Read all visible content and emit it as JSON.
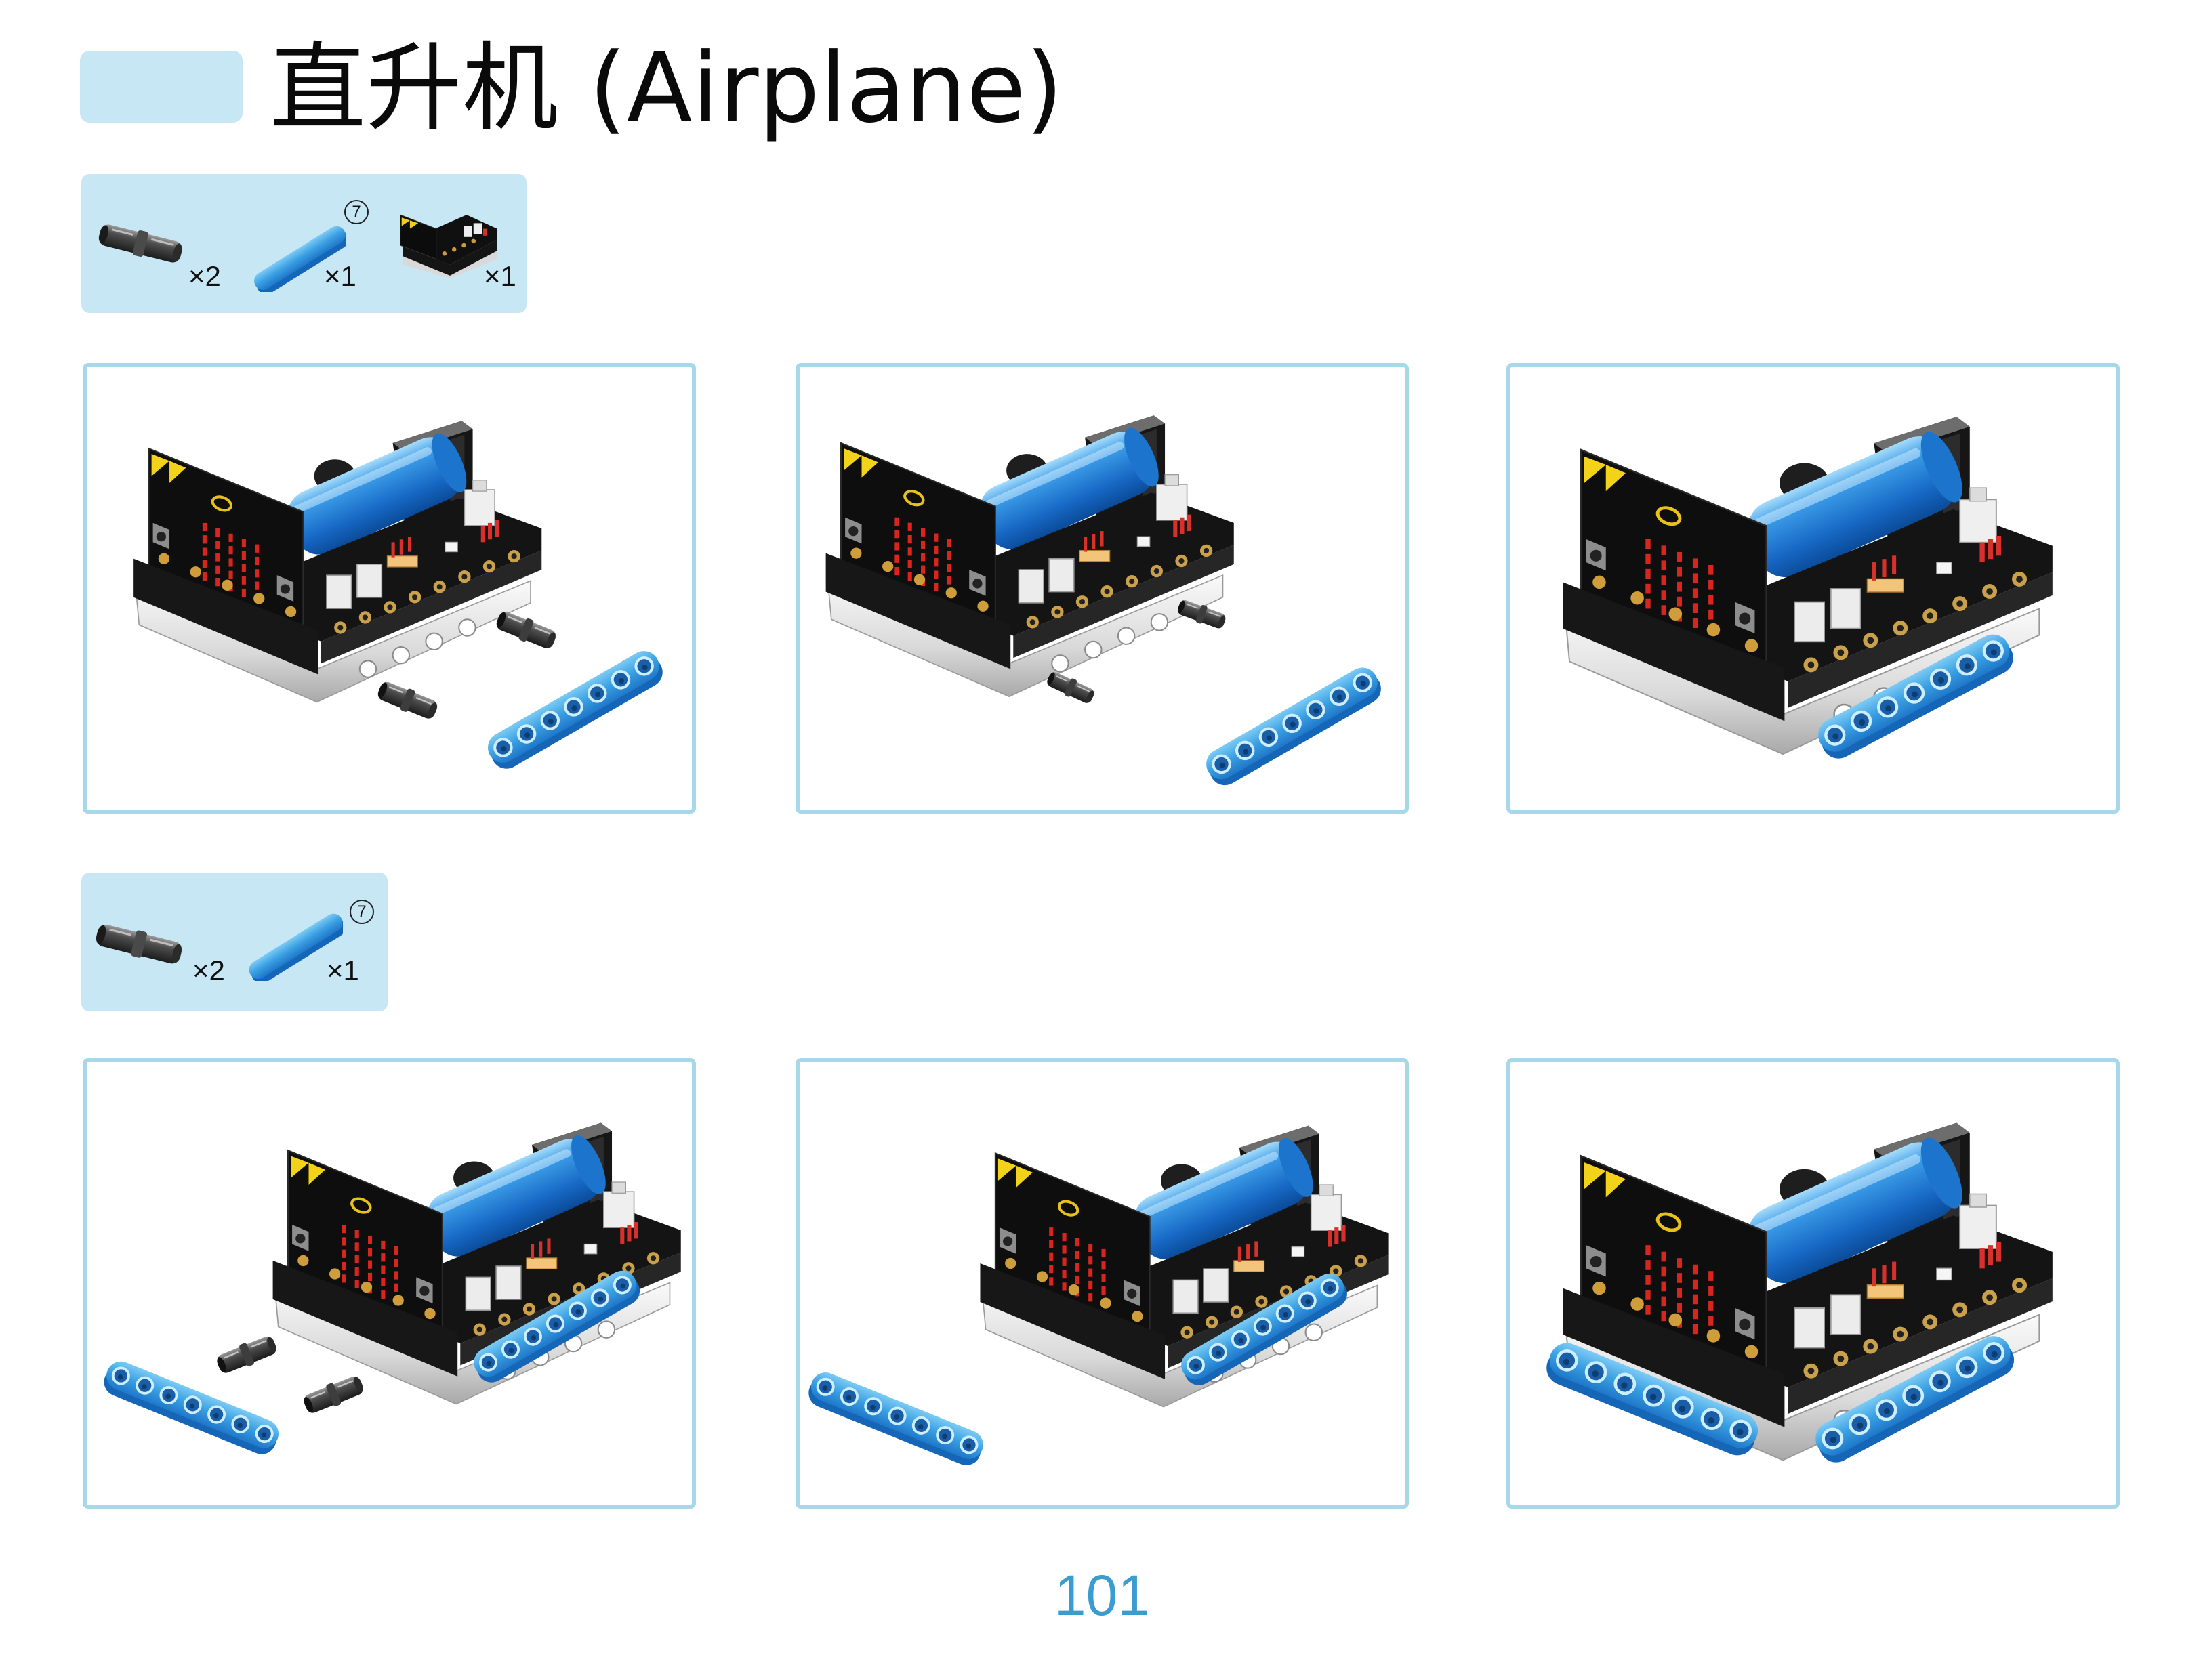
{
  "title": "直升机 (Airplane)",
  "colors": {
    "accent_light": "#c8e7f4",
    "panel_border": "#a6d8e9",
    "page_number": "#3b9ccf",
    "beam_blue": "#3a9fe2",
    "battery_blue": "#2a86dc"
  },
  "parts_lists": [
    {
      "items": [
        {
          "icon": "connector-pin-icon",
          "count": "×2"
        },
        {
          "icon": "blue-beam-icon",
          "count": "×1",
          "size_label": "7"
        },
        {
          "icon": "expansion-board-icon",
          "count": "×1"
        }
      ]
    },
    {
      "items": [
        {
          "icon": "connector-pin-icon",
          "count": "×2"
        },
        {
          "icon": "blue-beam-icon",
          "count": "×1",
          "size_label": "7"
        }
      ]
    }
  ],
  "page_number": "101"
}
